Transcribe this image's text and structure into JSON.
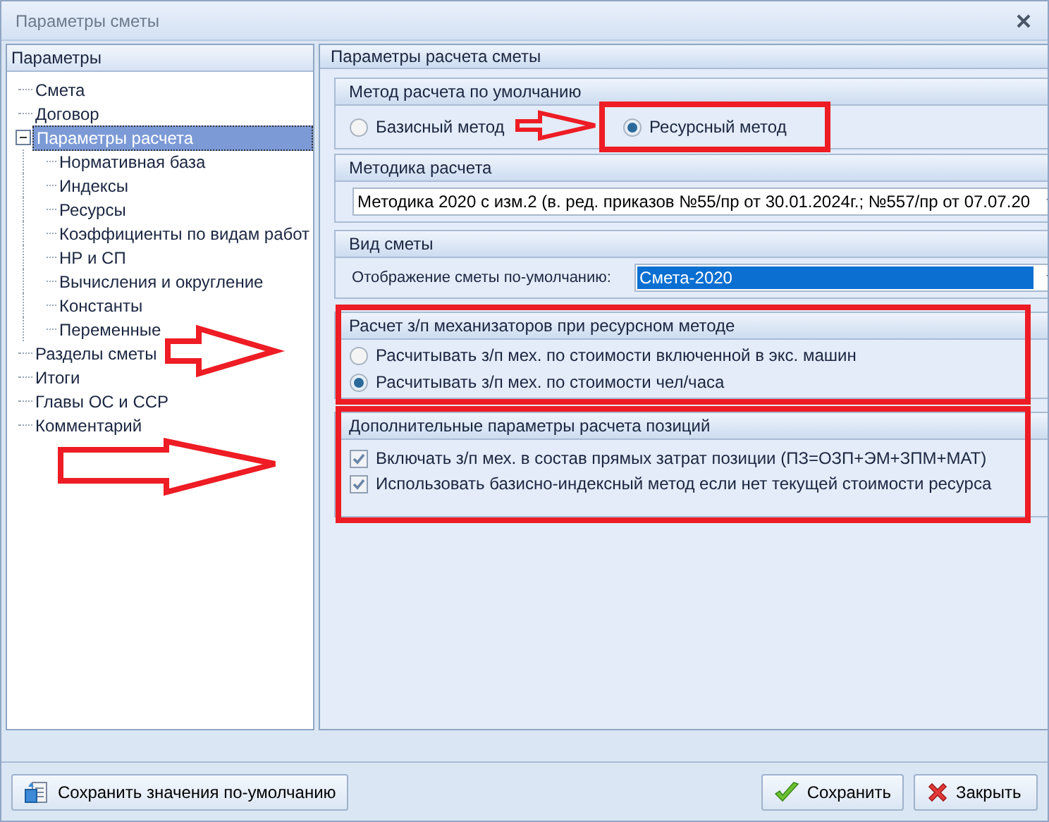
{
  "window": {
    "title": "Параметры сметы"
  },
  "sidebar": {
    "header": "Параметры",
    "items": [
      {
        "label": "Смета",
        "selected": false
      },
      {
        "label": "Договор",
        "selected": false
      },
      {
        "label": "Параметры расчета",
        "selected": true,
        "expanded": true,
        "children": [
          {
            "label": "Нормативная база",
            "selected": false
          },
          {
            "label": "Индексы",
            "selected": false
          },
          {
            "label": "Ресурсы",
            "selected": false
          },
          {
            "label": "Коэффициенты по видам работ",
            "selected": false
          },
          {
            "label": "НР и СП",
            "selected": false
          },
          {
            "label": "Вычисления и округление",
            "selected": false
          },
          {
            "label": "Константы",
            "selected": false
          },
          {
            "label": "Переменные",
            "selected": false
          }
        ]
      },
      {
        "label": "Разделы сметы",
        "selected": false
      },
      {
        "label": "Итоги",
        "selected": false
      },
      {
        "label": "Главы ОС и ССР",
        "selected": false
      },
      {
        "label": "Комментарий",
        "selected": false
      }
    ]
  },
  "panel": {
    "title": "Параметры расчета сметы",
    "groups": [
      {
        "kind": "radio-row",
        "title": "Метод расчета по умолчанию",
        "options": [
          {
            "label": "Базисный метод",
            "selected": false
          },
          {
            "label": "Ресурсный метод",
            "selected": true
          }
        ]
      },
      {
        "kind": "combo",
        "title": "Методика расчета",
        "value": "Методика 2020 с изм.2 (в. ред. приказов №55/пр от 30.01.2024г.; №557/пр от 07.07.20"
      },
      {
        "kind": "labeled-combo",
        "title": "Вид сметы",
        "label": "Отображение сметы по-умолчанию:",
        "value": "Смета-2020"
      },
      {
        "kind": "radio-list",
        "title": "Расчет з/п механизаторов при ресурсном методе",
        "options": [
          {
            "label": "Расчитывать з/п мех. по стоимости включенной в экс. машин",
            "selected": false
          },
          {
            "label": "Расчитывать з/п мех. по стоимости чел/часа",
            "selected": true
          }
        ]
      },
      {
        "kind": "checkbox-list",
        "title": "Дополнительные параметры расчета позиций",
        "options": [
          {
            "label": "Включать з/п мех. в состав прямых затрат позиции (ПЗ=ОЗП+ЭМ+ЗПМ+МАТ)",
            "checked": true
          },
          {
            "label": "Использовать базисно-индексный метод если нет текущей стоимости ресурса",
            "checked": true
          }
        ]
      }
    ]
  },
  "buttons": {
    "left": "Сохранить значения по-умолчанию",
    "save": "Сохранить",
    "close": "Закрыть"
  }
}
